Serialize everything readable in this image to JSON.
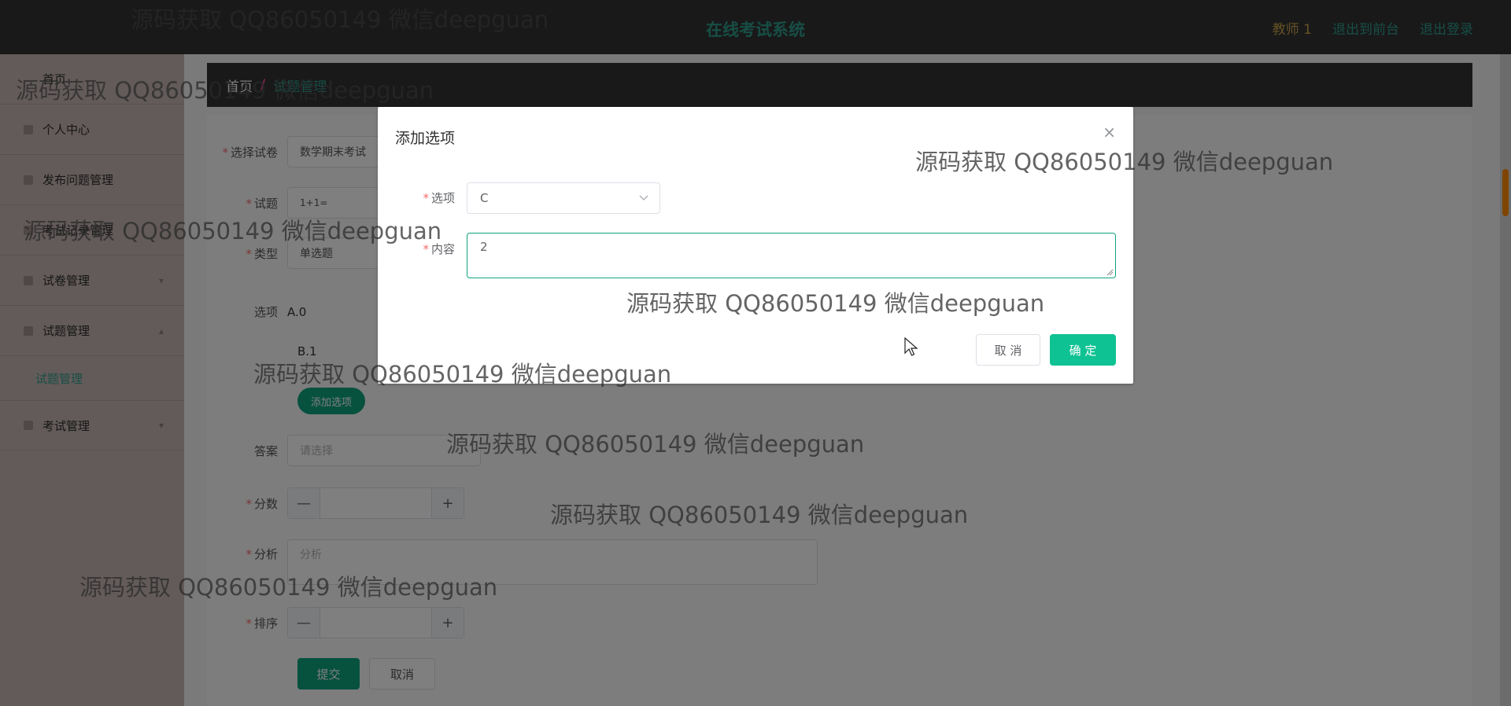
{
  "header": {
    "title": "在线考试系统",
    "user": "教师 1",
    "to_front": "退出到前台",
    "logout": "退出登录"
  },
  "sidebar": {
    "items": [
      {
        "label": "首页"
      },
      {
        "label": "个人中心"
      },
      {
        "label": "发布问题管理"
      },
      {
        "label": "考试记录管理"
      },
      {
        "label": "试卷管理"
      },
      {
        "label": "试题管理"
      },
      {
        "label": "考试管理"
      }
    ],
    "sub_item": "试题管理"
  },
  "breadcrumb": {
    "home": "首页",
    "separator": "/",
    "current": "试题管理"
  },
  "form": {
    "paper_label": "选择试卷",
    "paper_value": "数学期末考试",
    "question_label": "试题",
    "question_value": "1+1=",
    "type_label": "类型",
    "type_value": "单选题",
    "options_label": "选项",
    "option_a": "A.0",
    "option_b": "B.1",
    "add_option_btn": "添加选项",
    "answer_label": "答案",
    "answer_placeholder": "请选择",
    "score_label": "分数",
    "analysis_label": "分析",
    "analysis_placeholder": "分析",
    "order_label": "排序",
    "submit": "提交",
    "cancel": "取消",
    "stepper_minus": "—",
    "stepper_plus": "+"
  },
  "dialog": {
    "title": "添加选项",
    "close": "×",
    "option_label": "选项",
    "option_value": "C",
    "content_label": "内容",
    "content_value": "2",
    "cancel": "取 消",
    "ok": "确 定"
  },
  "watermark": "源码获取 QQ86050149 微信deepguan",
  "colors": {
    "accent": "#0fa37f",
    "header_bg": "#333333",
    "header_title": "#2e9c8a",
    "teacher": "#c9a24a",
    "scroll_thumb": "#ff8a00"
  },
  "icons": {
    "dropdown": "chevron-down-icon",
    "cursor": "mouse-pointer-icon"
  }
}
